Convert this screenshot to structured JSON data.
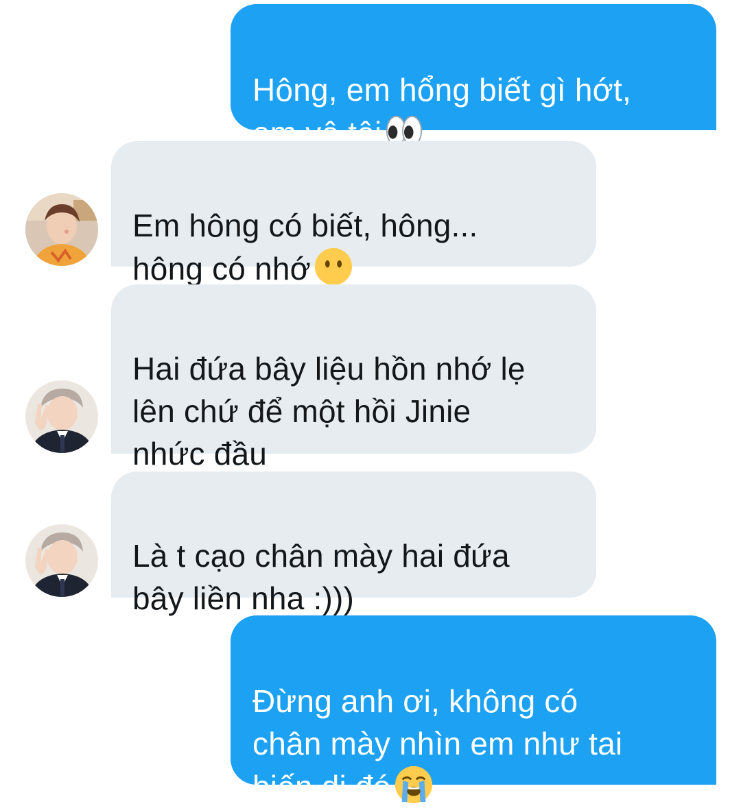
{
  "conversation": {
    "messages": [
      {
        "direction": "outgoing",
        "text": "Hông, em hổng biết gì hớt,\nem vô tội",
        "emoji": "eyes-emoji"
      },
      {
        "direction": "incoming",
        "text": "Em hông có biết, hông...\nhông có nhớ",
        "emoji": "no-mouth-face-emoji",
        "avatar": "avatar-orange-shirt"
      },
      {
        "direction": "incoming",
        "text": "Hai đứa bây liệu hồn nhớ lẹ\nlên chứ để một hồi Jinie\nnhức đầu",
        "avatar": "avatar-suit-peace-sign"
      },
      {
        "direction": "incoming",
        "text": "Là t cạo chân mày hai đứa\nbây liền nha :)))",
        "avatar": "avatar-suit-peace-sign"
      },
      {
        "direction": "outgoing",
        "text": "Đừng anh ơi, không có\nchân mày nhìn em như tai\nbiến dị đó",
        "emoji": "loudly-crying-face-emoji"
      }
    ]
  },
  "colors": {
    "outgoing_bubble": "#1da1f2",
    "incoming_bubble": "#e6ecf0",
    "outgoing_text": "#ffffff",
    "incoming_text": "#14171a"
  }
}
